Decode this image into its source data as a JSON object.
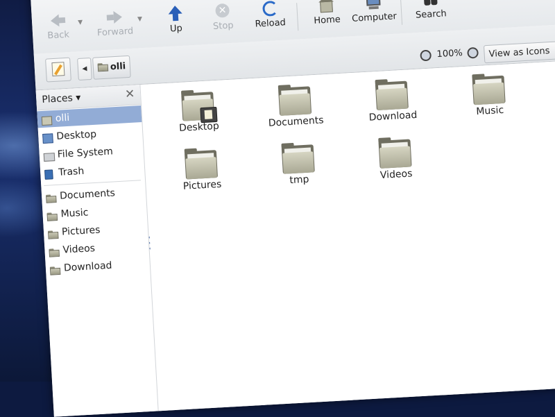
{
  "toolbar": {
    "back_label": "Back",
    "forward_label": "Forward",
    "up_label": "Up",
    "stop_label": "Stop",
    "reload_label": "Reload",
    "home_label": "Home",
    "computer_label": "Computer",
    "search_label": "Search"
  },
  "location": {
    "current_folder": "olli",
    "zoom_level": "100%",
    "view_mode": "View as Icons"
  },
  "sidebar": {
    "header": "Places",
    "places": [
      {
        "label": "olli",
        "icon": "home-folder-icon",
        "selected": true
      },
      {
        "label": "Desktop",
        "icon": "desktop-icon",
        "selected": false
      },
      {
        "label": "File System",
        "icon": "drive-icon",
        "selected": false
      },
      {
        "label": "Trash",
        "icon": "trash-icon",
        "selected": false
      }
    ],
    "bookmarks": [
      {
        "label": "Documents",
        "icon": "folder-icon"
      },
      {
        "label": "Music",
        "icon": "folder-icon"
      },
      {
        "label": "Pictures",
        "icon": "folder-icon"
      },
      {
        "label": "Videos",
        "icon": "folder-icon"
      },
      {
        "label": "Download",
        "icon": "folder-icon"
      }
    ]
  },
  "files": [
    {
      "name": "Desktop",
      "icon": "desktop-folder-icon"
    },
    {
      "name": "Documents",
      "icon": "folder-icon"
    },
    {
      "name": "Download",
      "icon": "folder-icon"
    },
    {
      "name": "Music",
      "icon": "folder-icon"
    },
    {
      "name": "Pictures",
      "icon": "folder-icon"
    },
    {
      "name": "tmp",
      "icon": "folder-icon"
    },
    {
      "name": "Videos",
      "icon": "folder-icon"
    }
  ],
  "colors": {
    "selection": "#92acd6",
    "folder": "#c9c8b4",
    "up_arrow": "#2a5fb8"
  }
}
